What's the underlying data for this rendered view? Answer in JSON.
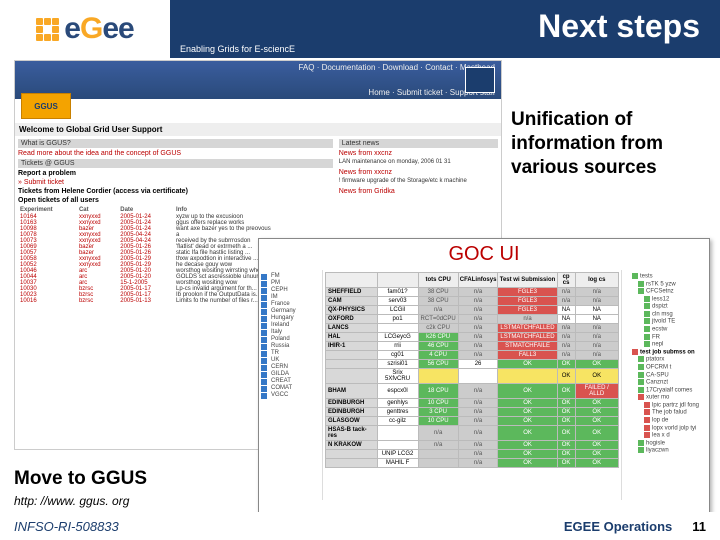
{
  "header": {
    "logo_text_parts": [
      "e",
      "G",
      "e",
      "e"
    ],
    "tagline": "Enabling Grids for E-sciencE",
    "title": "Next steps"
  },
  "overlay": {
    "unification": "Unification of information from various sources",
    "move": "Move to GGUS",
    "url": "http: //www. ggus. org"
  },
  "ggus": {
    "top_links": "FAQ · Documentation · Download · Contact · Masthead",
    "nav": "Home · Submit ticket · Support staff",
    "badge": "GGUS",
    "welcome": "Welcome to Global Grid User Support",
    "what_title": "What is GGUS?",
    "what_text": "Read more about the idea and the concept of GGUS",
    "tickets_title": "Tickets @ GGUS",
    "report": "Report a problem",
    "submit": "» Submit ticket",
    "cordier": "Tickets from Helene Cordier (access via certificate)",
    "open_title": "Open tickets of all users",
    "table_headers": [
      "Experiment",
      "Cat",
      "Date",
      "Info"
    ],
    "rows": [
      [
        "10164",
        "xxnyxxd",
        "2005-01-24",
        "xyzw up to the excusioon"
      ],
      [
        "10163",
        "xxnyxxd",
        "2005-01-24",
        "ggus offers replace works"
      ],
      [
        "10098",
        "bazer",
        "2005-01-24",
        "want axe bazer yes to the preovous"
      ],
      [
        "10078",
        "xxnyxxd",
        "2005-04-24",
        "a"
      ],
      [
        "10073",
        "xxnyxxd",
        "2005-04-24",
        "received by the subrrrosdon"
      ],
      [
        "10069",
        "bazer",
        "2005-01-26",
        "'flatlist' dead or extrmeth a ..."
      ],
      [
        "10057",
        "bazer",
        "2005-01-26",
        "static Ifa file hastlic listing ..."
      ],
      [
        "10058",
        "xxnyxxd",
        "2005-01-29",
        "thxw axpodtion in interactive ..."
      ],
      [
        "10052",
        "xxnyxxd",
        "2005-01-29",
        "he decase gouy wow"
      ],
      [
        "10046",
        "arc",
        "2005-01-20",
        "worsthog wositing wirrsting whe..."
      ],
      [
        "10044",
        "arc",
        "2005-01-20",
        "GOLDS sct ascressioble unuurnu"
      ],
      [
        "10037",
        "arc",
        "15-1-2005",
        "worsthog wositing wow"
      ],
      [
        "10030",
        "bzrsc",
        "2005-01-17",
        "Lp-cs invalid argument for th..."
      ],
      [
        "10023",
        "bzrsc",
        "2005-01-17",
        "Ib proolon if the OutputData is..."
      ],
      [
        "10016",
        "bzrsc",
        "2005-01-13",
        "Limits fo the number of files r..."
      ]
    ],
    "news_title": "Latest news",
    "news": [
      {
        "l1": "News from xxcnz",
        "l2": "LAN maintenance on monday, 2006 01 31"
      },
      {
        "l1": "News from xxcnz",
        "l2": "! firmware upgrade of the Storage/etc k machine"
      },
      {
        "l1": "News from Gridka",
        "l2": ""
      }
    ]
  },
  "goc": {
    "title": "GOC UI",
    "left_regions": [
      "FM",
      "PM",
      "CEPH",
      "IM",
      "France",
      "Germany",
      "Hungary",
      "Ireland",
      "Italy",
      "Poland",
      "Russia",
      "TR",
      "UK",
      "CERN",
      "GILDA",
      "CREAT",
      "COMAT",
      "VGCC"
    ],
    "headers": [
      "",
      "",
      "tots CPU",
      "CFALinfosys",
      "Test wi Submission",
      "cp cs",
      "log cs"
    ],
    "rows": [
      {
        "site": "SHEFFIELD",
        "cells": [
          [
            "fam01?",
            ""
          ],
          [
            "38 CPU",
            "gray"
          ],
          [
            "n/a",
            "gray"
          ],
          [
            "FGLE3",
            "red"
          ],
          [
            "n/a",
            "gray"
          ],
          [
            "n/a",
            "gray"
          ]
        ]
      },
      {
        "site": "CAM",
        "cells": [
          [
            "serv03",
            ""
          ],
          [
            "38 CPU",
            "gray"
          ],
          [
            "n/a",
            "gray"
          ],
          [
            "FGLE3",
            "red"
          ],
          [
            "n/a",
            "gray"
          ],
          [
            "n/a",
            "gray"
          ]
        ]
      },
      {
        "site": "QX-PHYSICS",
        "cells": [
          [
            "LCGil",
            ""
          ],
          [
            "n/a",
            "gray"
          ],
          [
            "n/a",
            "gray"
          ],
          [
            "FGLE3",
            "red"
          ],
          [
            "NA",
            ""
          ],
          [
            "NA",
            ""
          ]
        ]
      },
      {
        "site": "OXFORD",
        "cells": [
          [
            "po1",
            ""
          ],
          [
            "RCT=0dCPU",
            "gray"
          ],
          [
            "n/a",
            "gray"
          ],
          [
            "n/a",
            "gray"
          ],
          [
            "NA",
            ""
          ],
          [
            "NA",
            ""
          ]
        ]
      },
      {
        "site": "LANCS",
        "cells": [
          [
            "",
            ""
          ],
          [
            "c2k CPU",
            "gray"
          ],
          [
            "n/a",
            "gray"
          ],
          [
            "LSTMATCHFALLED",
            "red"
          ],
          [
            "n/a",
            "gray"
          ],
          [
            "n/a",
            "gray"
          ]
        ]
      },
      {
        "site": "HAL",
        "cells": [
          [
            "LCGeycG",
            ""
          ],
          [
            "k26 CPU",
            "green"
          ],
          [
            "n/a",
            "gray"
          ],
          [
            "LSTMATCHFALLED",
            "red"
          ],
          [
            "n/a",
            "gray"
          ],
          [
            "n/a",
            "gray"
          ]
        ]
      },
      {
        "site": "IHIR-1",
        "cells": [
          [
            "rrii",
            ""
          ],
          [
            "46 CPU",
            "green"
          ],
          [
            "n/a",
            "gray"
          ],
          [
            "STMATCHFAILE",
            "red"
          ],
          [
            "n/a",
            "gray"
          ],
          [
            "n/a",
            "gray"
          ]
        ]
      },
      {
        "site": "",
        "cells": [
          [
            "cg01 ",
            ""
          ],
          [
            "4 CPU",
            "green"
          ],
          [
            "n/a",
            "gray"
          ],
          [
            "FALL3",
            "red"
          ],
          [
            "n/a",
            "gray"
          ],
          [
            "n/a",
            "gray"
          ]
        ]
      },
      {
        "site": "",
        "cells": [
          [
            "szrisi01",
            ""
          ],
          [
            "56 CPU",
            "green"
          ],
          [
            "26",
            ""
          ],
          [
            "OK",
            "green"
          ],
          [
            "OK",
            "green"
          ],
          [
            "OK",
            "green"
          ]
        ]
      },
      {
        "site": "",
        "cells": [
          [
            "Srix 5XfvCRU",
            ""
          ],
          [
            "",
            "yellow"
          ],
          [
            "",
            ""
          ],
          [
            "",
            "yellow"
          ],
          [
            "OK",
            "yellow"
          ],
          [
            "OK",
            "yellow"
          ]
        ]
      },
      {
        "site": "BHAM",
        "cells": [
          [
            "espcx0l",
            ""
          ],
          [
            "18 CPU",
            "green"
          ],
          [
            "n/a",
            "gray"
          ],
          [
            "OK",
            "green"
          ],
          [
            "OK",
            "green"
          ],
          [
            "FAILED / ALLD",
            "red"
          ]
        ]
      },
      {
        "site": "EDINBURGH",
        "cells": [
          [
            "genhlys",
            ""
          ],
          [
            "10 CPU",
            "green"
          ],
          [
            "n/a",
            "gray"
          ],
          [
            "OK",
            "green"
          ],
          [
            "OK",
            "green"
          ],
          [
            "OK",
            "green"
          ]
        ]
      },
      {
        "site": "EDINBURGH",
        "cells": [
          [
            "genttres",
            ""
          ],
          [
            "3 CPU",
            "green"
          ],
          [
            "n/a",
            "gray"
          ],
          [
            "OK",
            "green"
          ],
          [
            "OK",
            "green"
          ],
          [
            "OK",
            "green"
          ]
        ]
      },
      {
        "site": "GLASGOW",
        "cells": [
          [
            "cc-gilz",
            ""
          ],
          [
            "10 CPU",
            "green"
          ],
          [
            "n/a",
            "gray"
          ],
          [
            "OK",
            "green"
          ],
          [
            "OK",
            "green"
          ],
          [
            "OK",
            "green"
          ]
        ]
      },
      {
        "site": "HSAS-B tack-res",
        "cells": [
          [
            "",
            ""
          ],
          [
            "n/a",
            "gray"
          ],
          [
            "n/a",
            "gray"
          ],
          [
            "OK",
            "green"
          ],
          [
            "OK",
            "green"
          ],
          [
            "OK",
            "green"
          ]
        ]
      },
      {
        "site": "N KRAKOW",
        "cells": [
          [
            "",
            ""
          ],
          [
            "n/a",
            "gray"
          ],
          [
            "n/a",
            "gray"
          ],
          [
            "OK",
            "green"
          ],
          [
            "OK",
            "green"
          ],
          [
            "OK",
            "green"
          ]
        ]
      },
      {
        "site": "",
        "cells": [
          [
            "UNIP LCG2",
            ""
          ],
          [
            "",
            "gray"
          ],
          [
            "n/a",
            "gray"
          ],
          [
            "OK",
            "green"
          ],
          [
            "OK",
            "green"
          ],
          [
            "OK",
            "green"
          ]
        ]
      },
      {
        "site": "",
        "cells": [
          [
            "MAHIL F",
            ""
          ],
          [
            "",
            "gray"
          ],
          [
            "n/a",
            "gray"
          ],
          [
            "OK",
            "green"
          ],
          [
            "OK",
            "green"
          ],
          [
            "OK",
            "green"
          ]
        ]
      }
    ],
    "right_tree": [
      {
        "t": "tests",
        "i": "g"
      },
      {
        "t": "rsTK 5 yzw",
        "i": "g",
        "pad": 1
      },
      {
        "t": "CFCSetnz",
        "i": "g",
        "pad": 1
      },
      {
        "t": "less12",
        "i": "g",
        "pad": 2
      },
      {
        "t": "dspizt",
        "i": "g",
        "pad": 2
      },
      {
        "t": "cln msg",
        "i": "g",
        "pad": 2
      },
      {
        "t": "jtvold TE",
        "i": "g",
        "pad": 2
      },
      {
        "t": "ecstw",
        "i": "g",
        "pad": 2
      },
      {
        "t": "FR",
        "i": "g",
        "pad": 2
      },
      {
        "t": "nepl",
        "i": "g",
        "pad": 2
      },
      {
        "t": "test job submss on",
        "i": "r",
        "pad": 0,
        "b": 1
      },
      {
        "t": "ptatorx",
        "i": "g",
        "pad": 1
      },
      {
        "t": "OFCRM t",
        "i": "g",
        "pad": 1
      },
      {
        "t": "CA-SPU",
        "i": "g",
        "pad": 1
      },
      {
        "t": "Canznzt",
        "i": "g",
        "pad": 1
      },
      {
        "t": "17Cryaialf comes",
        "i": "g",
        "pad": 1
      },
      {
        "t": "xuter mo",
        "i": "r",
        "pad": 1
      },
      {
        "t": "lpic partrz jdl fong",
        "i": "r",
        "pad": 2
      },
      {
        "t": "The job falud",
        "i": "r",
        "pad": 2
      },
      {
        "t": "lop de",
        "i": "r",
        "pad": 2
      },
      {
        "t": "lopx vorld jolp tyi",
        "i": "r",
        "pad": 2
      },
      {
        "t": "lea x d",
        "i": "r",
        "pad": 2
      },
      {
        "t": "hogisle",
        "i": "g",
        "pad": 1
      },
      {
        "t": "liyaczwn",
        "i": "g",
        "pad": 1
      }
    ]
  },
  "footer": {
    "left": "INFSO-RI-508833",
    "right": "EGEE Operations",
    "page": "11"
  }
}
